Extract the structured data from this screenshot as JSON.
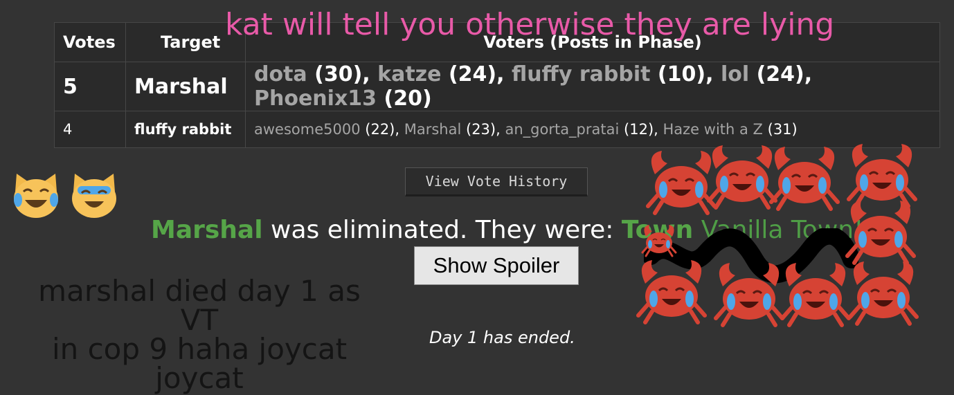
{
  "overlay_caption": "kat will tell you otherwise they are lying",
  "table": {
    "headers": {
      "votes": "Votes",
      "target": "Target",
      "voters": "Voters (Posts in Phase)"
    },
    "rows": [
      {
        "votes": "5",
        "target": "Marshal",
        "voters": [
          {
            "name": "dota",
            "posts": "(30)",
            "sep": ", "
          },
          {
            "name": "katze",
            "posts": "(24)",
            "sep": ", "
          },
          {
            "name": "fluffy rabbit",
            "posts": "(10)",
            "sep": ", "
          },
          {
            "name": "lol",
            "posts": "(24)",
            "sep": ", "
          },
          {
            "name": "Phoenix13",
            "posts": "(20)",
            "sep": ""
          }
        ]
      },
      {
        "votes": "4",
        "target": "fluffy rabbit",
        "voters": [
          {
            "name": "awesome5000",
            "posts": "(22)",
            "sep": ", "
          },
          {
            "name": "Marshal",
            "posts": "(23)",
            "sep": ", "
          },
          {
            "name": "an_gorta_pratai",
            "posts": "(12)",
            "sep": ", "
          },
          {
            "name": "Haze with a Z",
            "posts": "(31)",
            "sep": ""
          }
        ]
      }
    ]
  },
  "vote_history_button": "View Vote History",
  "elimination": {
    "player": "Marshal",
    "text": " was eliminated. They were: ",
    "alignment": "Town",
    "role_text": "Vanilla Town!"
  },
  "spoiler_button": "Show Spoiler",
  "day_status": "Day 1 has ended.",
  "note_lines": [
    "marshal died day 1 as VT",
    "in cop 9 haha joycat joycat"
  ],
  "icons": {
    "cat": "joy-cat-icon",
    "crab": "crying-laughing-crab-icon"
  },
  "colors": {
    "background": "#333333",
    "caption": "#e85aa8",
    "town_green": "#56a548",
    "voter_name": "#a5a5a5"
  }
}
